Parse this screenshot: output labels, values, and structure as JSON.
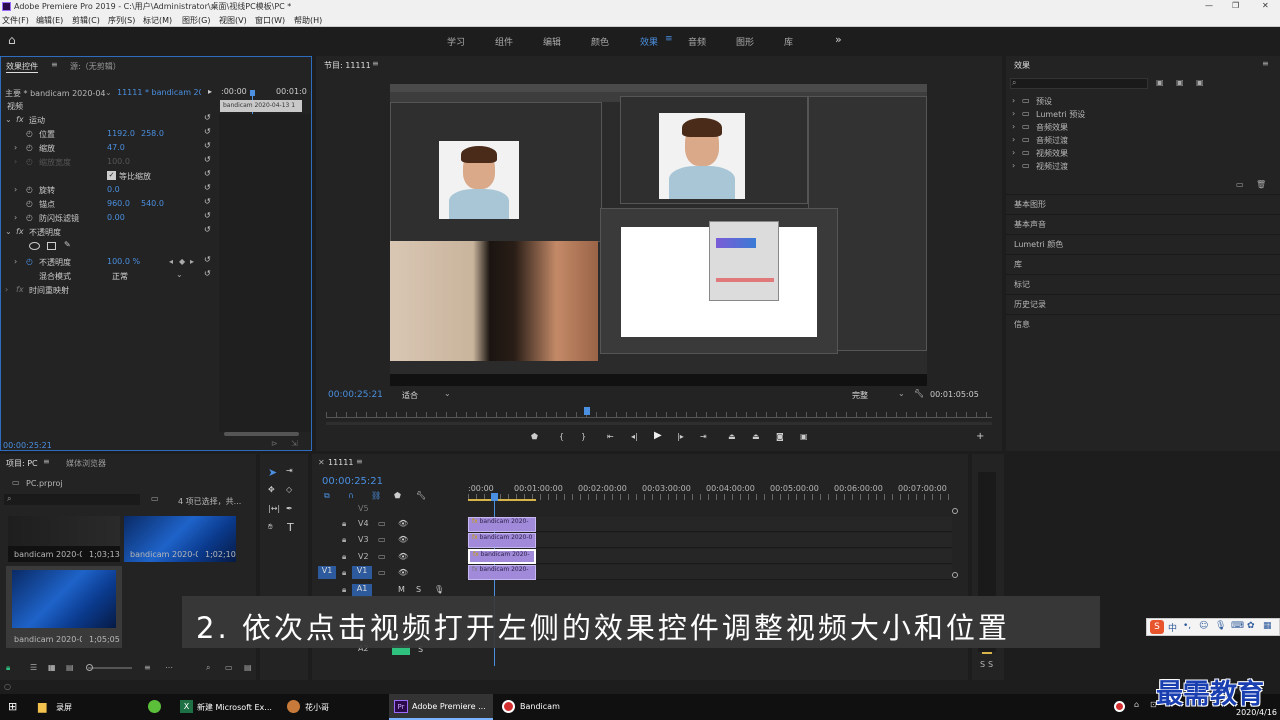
{
  "titlebar": {
    "title": "Adobe Premiere Pro 2019 - C:\\用户\\Administrator\\桌面\\视线PC模板\\PC *",
    "controls": [
      "—",
      "❐",
      "✕"
    ]
  },
  "menubar": [
    "文件(F)",
    "编辑(E)",
    "剪辑(C)",
    "序列(S)",
    "标记(M)",
    "图形(G)",
    "视图(V)",
    "窗口(W)",
    "帮助(H)"
  ],
  "workspaces": {
    "tabs": [
      "学习",
      "组件",
      "编辑",
      "颜色",
      "效果",
      "音频",
      "图形",
      "库"
    ],
    "active": "效果",
    "more": "»"
  },
  "effect_controls": {
    "tab_active": "效果控件",
    "tab_source": "源:（无剪辑）",
    "master": "主要 * bandicam 2020-04...",
    "sequence": "11111 * bandicam 202...",
    "time_start": ":00:00",
    "time_end": "00:01:0",
    "clip_label": "bandicam 2020-04-13 1",
    "section_video": "视频",
    "motion": "运动",
    "position_label": "位置",
    "position_x": "1192.0",
    "position_y": "258.0",
    "scale_label": "缩放",
    "scale_value": "47.0",
    "scale_width_label": "缩放宽度",
    "scale_width_value": "100.0",
    "uniform_scale": "等比缩放",
    "rotation_label": "旋转",
    "rotation_value": "0.0",
    "anchor_label": "锚点",
    "anchor_x": "960.0",
    "anchor_y": "540.0",
    "flicker_label": "防闪烁滤镜",
    "flicker_value": "0.00",
    "opacity_section": "不透明度",
    "opacity_label": "不透明度",
    "opacity_value": "100.0 %",
    "blend_label": "混合模式",
    "blend_value": "正常",
    "time_remap": "时间重映射",
    "footer_time": "00:00:25:21"
  },
  "program_monitor": {
    "title": "节目: 11111",
    "timecode": "00:00:25:21",
    "fit": "适合",
    "quality": "完整",
    "duration": "00:01:05:05"
  },
  "effects_panel": {
    "title": "效果",
    "tree": [
      "预设",
      "Lumetri 预设",
      "音频效果",
      "音频过渡",
      "视频效果",
      "视频过渡"
    ],
    "sections": [
      "基本图形",
      "基本声音",
      "Lumetri 颜色",
      "库",
      "标记",
      "历史记录",
      "信息"
    ]
  },
  "project_panel": {
    "tab_project": "项目: PC",
    "tab_media": "媒体浏览器",
    "file": "PC.prproj",
    "selection": "4 项已选择，共...",
    "clips": [
      {
        "name": "bandicam 2020-04-...",
        "duration": "1;03;13"
      },
      {
        "name": "bandicam 2020-04-...",
        "duration": "1;02;10"
      },
      {
        "name": "bandicam 2020-04-...",
        "duration": "1;05;05"
      }
    ]
  },
  "timeline": {
    "sequence": "11111",
    "timecode": "00:00:25:21",
    "ruler": [
      ":00:00",
      "00:01:00:00",
      "00:02:00:00",
      "00:03:00:00",
      "00:04:00:00",
      "00:05:00:00",
      "00:06:00:00",
      "00:07:00:00"
    ],
    "tracks": [
      "V5",
      "V4",
      "V3",
      "V2",
      "V1",
      "A1",
      "A2"
    ],
    "source_patch": "V1",
    "clips": [
      {
        "track": "V4",
        "label": "bandicam 2020-"
      },
      {
        "track": "V3",
        "label": "bandicam 2020-0"
      },
      {
        "track": "V2",
        "label": "bandicam 2020-"
      },
      {
        "track": "V1",
        "label": "bandicam 2020-"
      }
    ],
    "meter_labels": [
      "S",
      "S"
    ]
  },
  "subtitle": "2. 依次点击视频打开左侧的效果控件调整视频大小和位置",
  "watermark": "最需教育",
  "ime_bar": "中",
  "taskbar": {
    "items": [
      "录屏",
      "新建 Microsoft Ex...",
      "花小哥",
      "Adobe Premiere ...",
      "Bandicam"
    ],
    "date": "2020/4/16"
  },
  "colors": {
    "accent_blue": "#4a8fe0",
    "clip_purple": "#a08ad9",
    "audio_green": "#2ec27e",
    "subtitle_bg": "#3a3a3a"
  }
}
